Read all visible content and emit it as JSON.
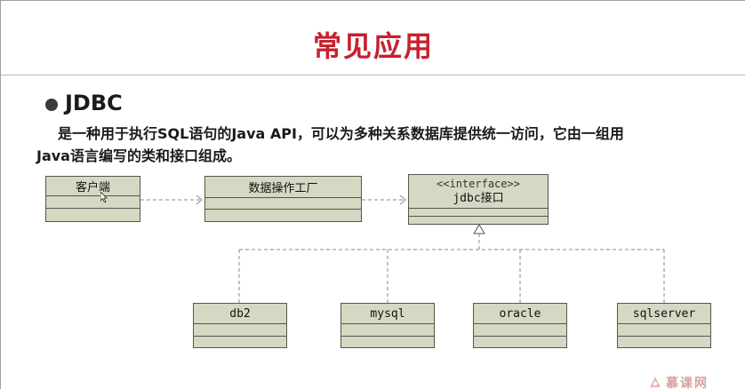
{
  "slide": {
    "title": "常见应用",
    "heading": "JDBC",
    "paragraph_line1": "是一种用于执行SQL语句的Java  API，可以为多种关系数据库提供统一访问，它由一组用",
    "paragraph_line2": "Java语言编写的类和接口组成。"
  },
  "diagram": {
    "client": "客户端",
    "factory": "数据操作工厂",
    "interface_stereotype": "<<interface>>",
    "interface_name": "jdbc接口",
    "implementations": [
      "db2",
      "mysql",
      "oracle",
      "sqlserver"
    ]
  },
  "watermark": {
    "text": "慕课网"
  },
  "colors": {
    "title": "#c8202e",
    "box_fill": "#d6d8c4",
    "box_border": "#55584a",
    "connector": "#8a8a8a"
  }
}
